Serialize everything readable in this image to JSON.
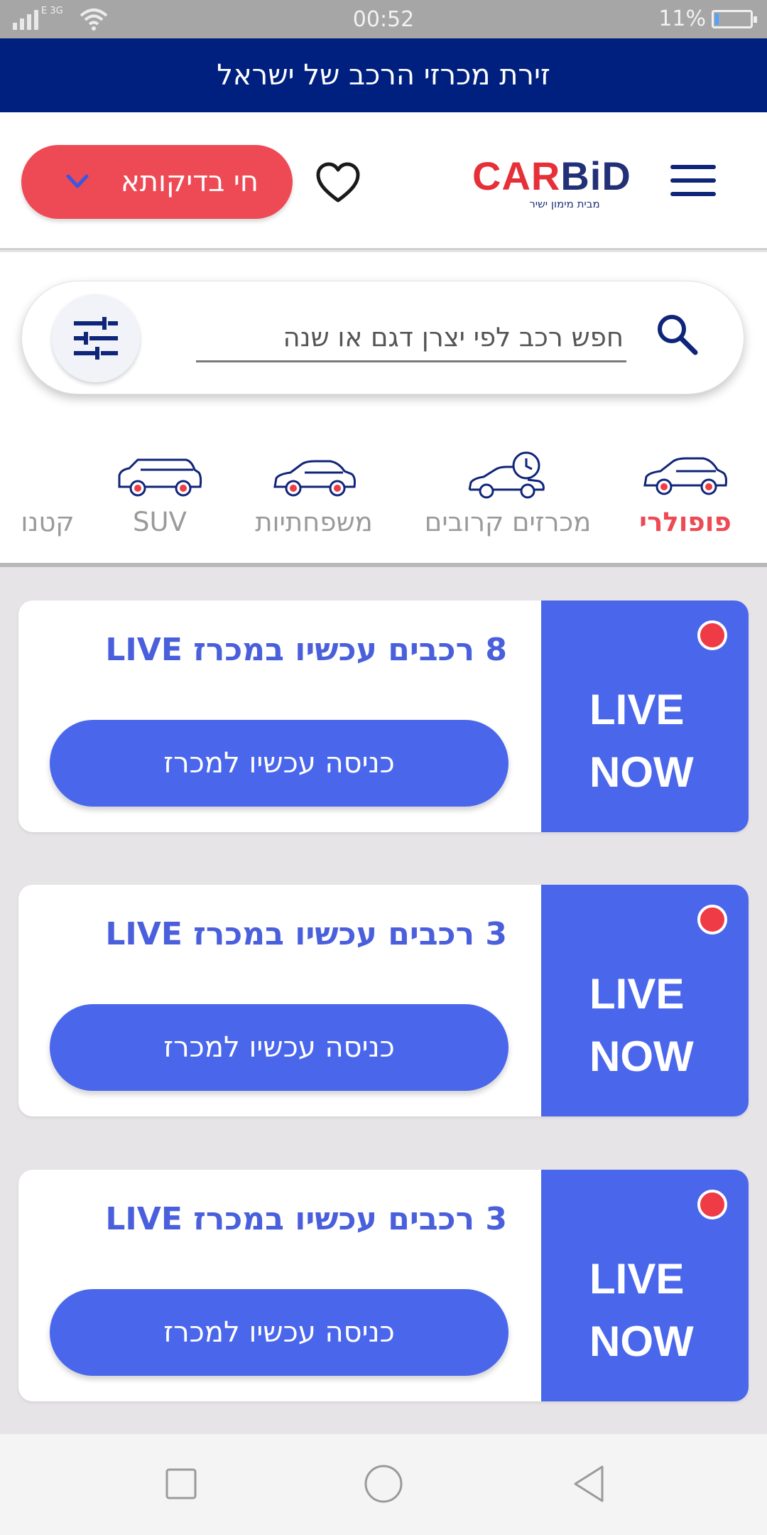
{
  "status_bar": {
    "network": "E 3G",
    "time": "00:52",
    "battery": "11%",
    "battery_level": 0.11
  },
  "banner": {
    "text": "זירת מכרזי הרכב של ישראל"
  },
  "header": {
    "logo_text": "CARBiD",
    "logo_tagline": "מבית מימון ישיר",
    "account_label": "חי בדיקותא"
  },
  "search": {
    "placeholder": "חפש רכב לפי יצרן דגם או שנה"
  },
  "categories": [
    {
      "label": "פופולרי",
      "active": true
    },
    {
      "label": "מכרזים קרובים",
      "active": false
    },
    {
      "label": "משפחתיות",
      "active": false
    },
    {
      "label": "SUV",
      "active": false
    },
    {
      "label": "קטנו",
      "active": false
    }
  ],
  "auctions": [
    {
      "live_line1": "LIVE",
      "live_line2": "NOW",
      "title": "8 רכבים עכשיו במכרז LIVE",
      "button": "כניסה עכשיו למכרז"
    },
    {
      "live_line1": "LIVE",
      "live_line2": "NOW",
      "title": "3 רכבים עכשיו במכרז LIVE",
      "button": "כניסה עכשיו למכרז"
    },
    {
      "live_line1": "LIVE",
      "live_line2": "NOW",
      "title": "3 רכבים עכשיו במכרז LIVE",
      "button": "כניסה עכשיו למכרז"
    }
  ],
  "colors": {
    "brand_blue": "#00207f",
    "accent_red": "#ee4a55",
    "live_blue": "#4a67ec"
  }
}
